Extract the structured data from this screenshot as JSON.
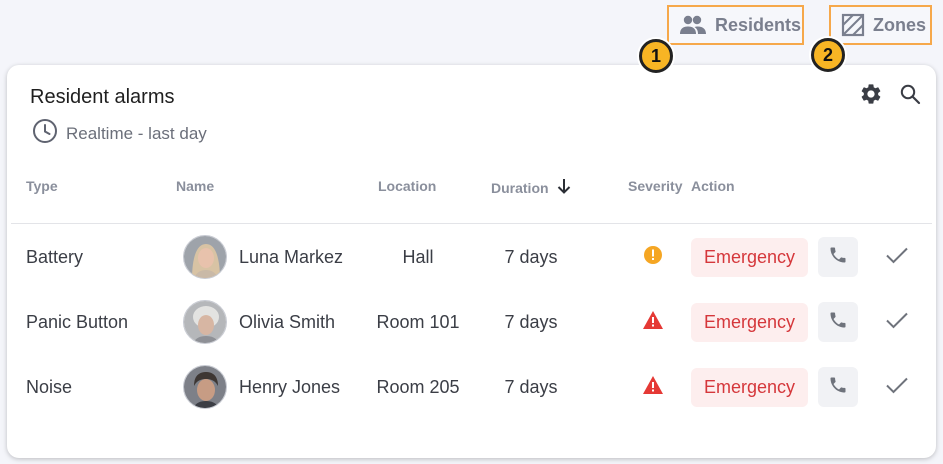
{
  "topnav": {
    "residents_label": "Residents",
    "zones_label": "Zones",
    "badges": [
      "1",
      "2"
    ]
  },
  "card": {
    "title": "Resident alarms",
    "subtitle": "Realtime - last day"
  },
  "table": {
    "headers": {
      "type": "Type",
      "name": "Name",
      "location": "Location",
      "duration": "Duration",
      "severity": "Severity",
      "action": "Action"
    },
    "sort_column": "duration",
    "sort_direction": "descending",
    "rows": [
      {
        "type": "Battery",
        "name": "Luna Markez",
        "location": "Hall",
        "duration": "7 days",
        "severity": "warning",
        "action": "Emergency"
      },
      {
        "type": "Panic Button",
        "name": "Olivia Smith",
        "location": "Room 101",
        "duration": "7 days",
        "severity": "critical",
        "action": "Emergency"
      },
      {
        "type": "Noise",
        "name": "Henry Jones",
        "location": "Room 205",
        "duration": "7 days",
        "severity": "critical",
        "action": "Emergency"
      }
    ]
  },
  "colors": {
    "accent_orange": "#f6a84a",
    "badge": "#f8b524",
    "warning": "#f5a623",
    "critical": "#e53935",
    "emergency_text": "#d5373b",
    "emergency_bg": "#fdeeee"
  },
  "icons": {
    "residents": "people-icon",
    "zones": "zones-hatch-icon",
    "subtitle": "clock-icon",
    "settings": "gear-icon",
    "search": "search-icon",
    "sort": "arrow-down-icon",
    "phone": "phone-icon",
    "acknowledge": "check-icon"
  }
}
